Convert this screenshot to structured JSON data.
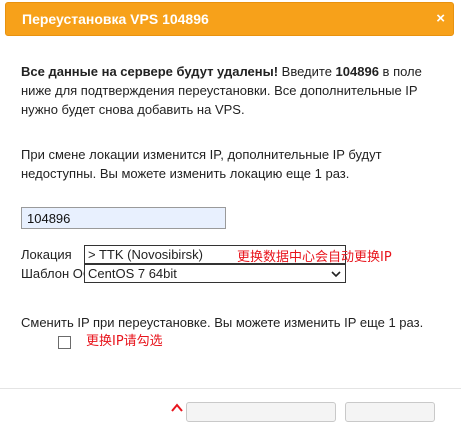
{
  "dialog": {
    "title": "Переустановка VPS 104896",
    "close_label": "×"
  },
  "warning": {
    "bold_prefix": "Все данные на сервере будут удалены!",
    "text_before_id": " Введите ",
    "vps_id": "104896",
    "text_after_id": " в поле ниже для подтверждения переустановки. Все дополнительные IP нужно будет снова добавить на VPS."
  },
  "location_note": "При смене локации изменится IP, дополнительные IP будут недоступны. Вы можете изменить локацию еще 1 раз.",
  "confirm_input": {
    "value": "104896"
  },
  "location": {
    "label": "Локация",
    "selected": "> TTK (Novosibirsk)"
  },
  "template": {
    "label": "Шаблон ОС",
    "selected": "CentOS 7 64bit"
  },
  "change_ip": {
    "text": "Сменить IP при переустановке. Вы можете изменить IP еще 1 раз.",
    "checked": false
  },
  "annotations": {
    "location_note": "更换数据中心会自动更换IP",
    "ip_note": "更换IP请勾选"
  },
  "colors": {
    "titlebar": "#f7a11a",
    "annotation": "#e8141c"
  }
}
